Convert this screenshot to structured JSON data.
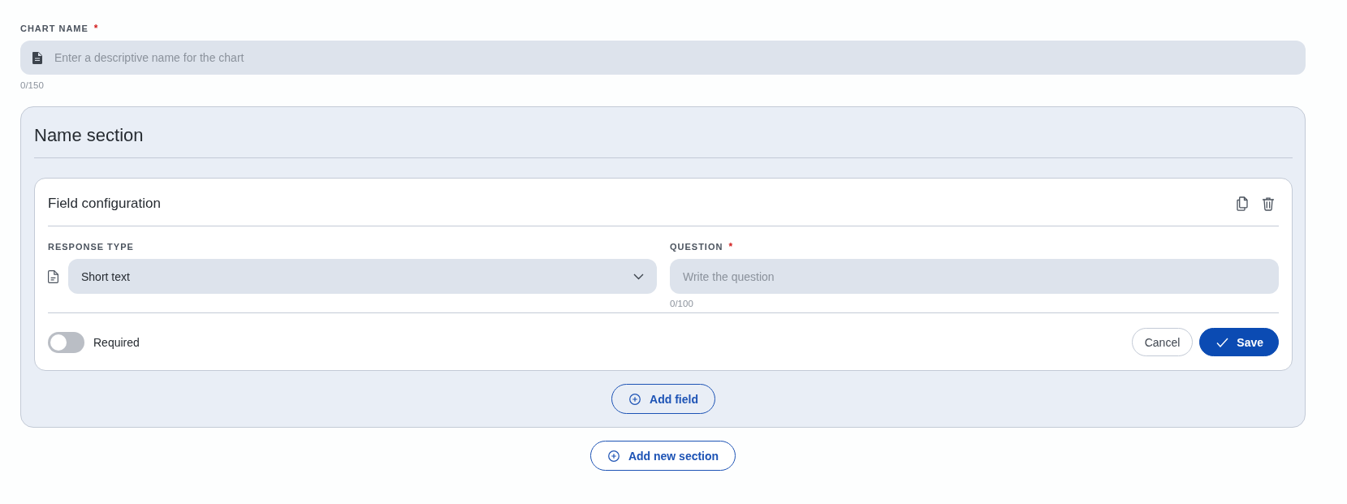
{
  "chart_name": {
    "label": "CHART NAME",
    "required_mark": "*",
    "placeholder": "Enter a descriptive name for the chart",
    "counter": "0/150"
  },
  "section": {
    "title": "Name section",
    "field_card": {
      "title": "Field configuration",
      "response_type": {
        "label": "RESPONSE TYPE",
        "value": "Short text"
      },
      "question": {
        "label": "QUESTION",
        "required_mark": "*",
        "placeholder": "Write the question",
        "counter": "0/100"
      },
      "required_toggle": {
        "label": "Required",
        "on": false
      },
      "buttons": [
        {
          "label": "Cancel",
          "kind": "secondary"
        },
        {
          "label": "Save",
          "kind": "primary"
        }
      ]
    },
    "add_field_button": "Add field"
  },
  "add_section_button": "Add new section"
}
